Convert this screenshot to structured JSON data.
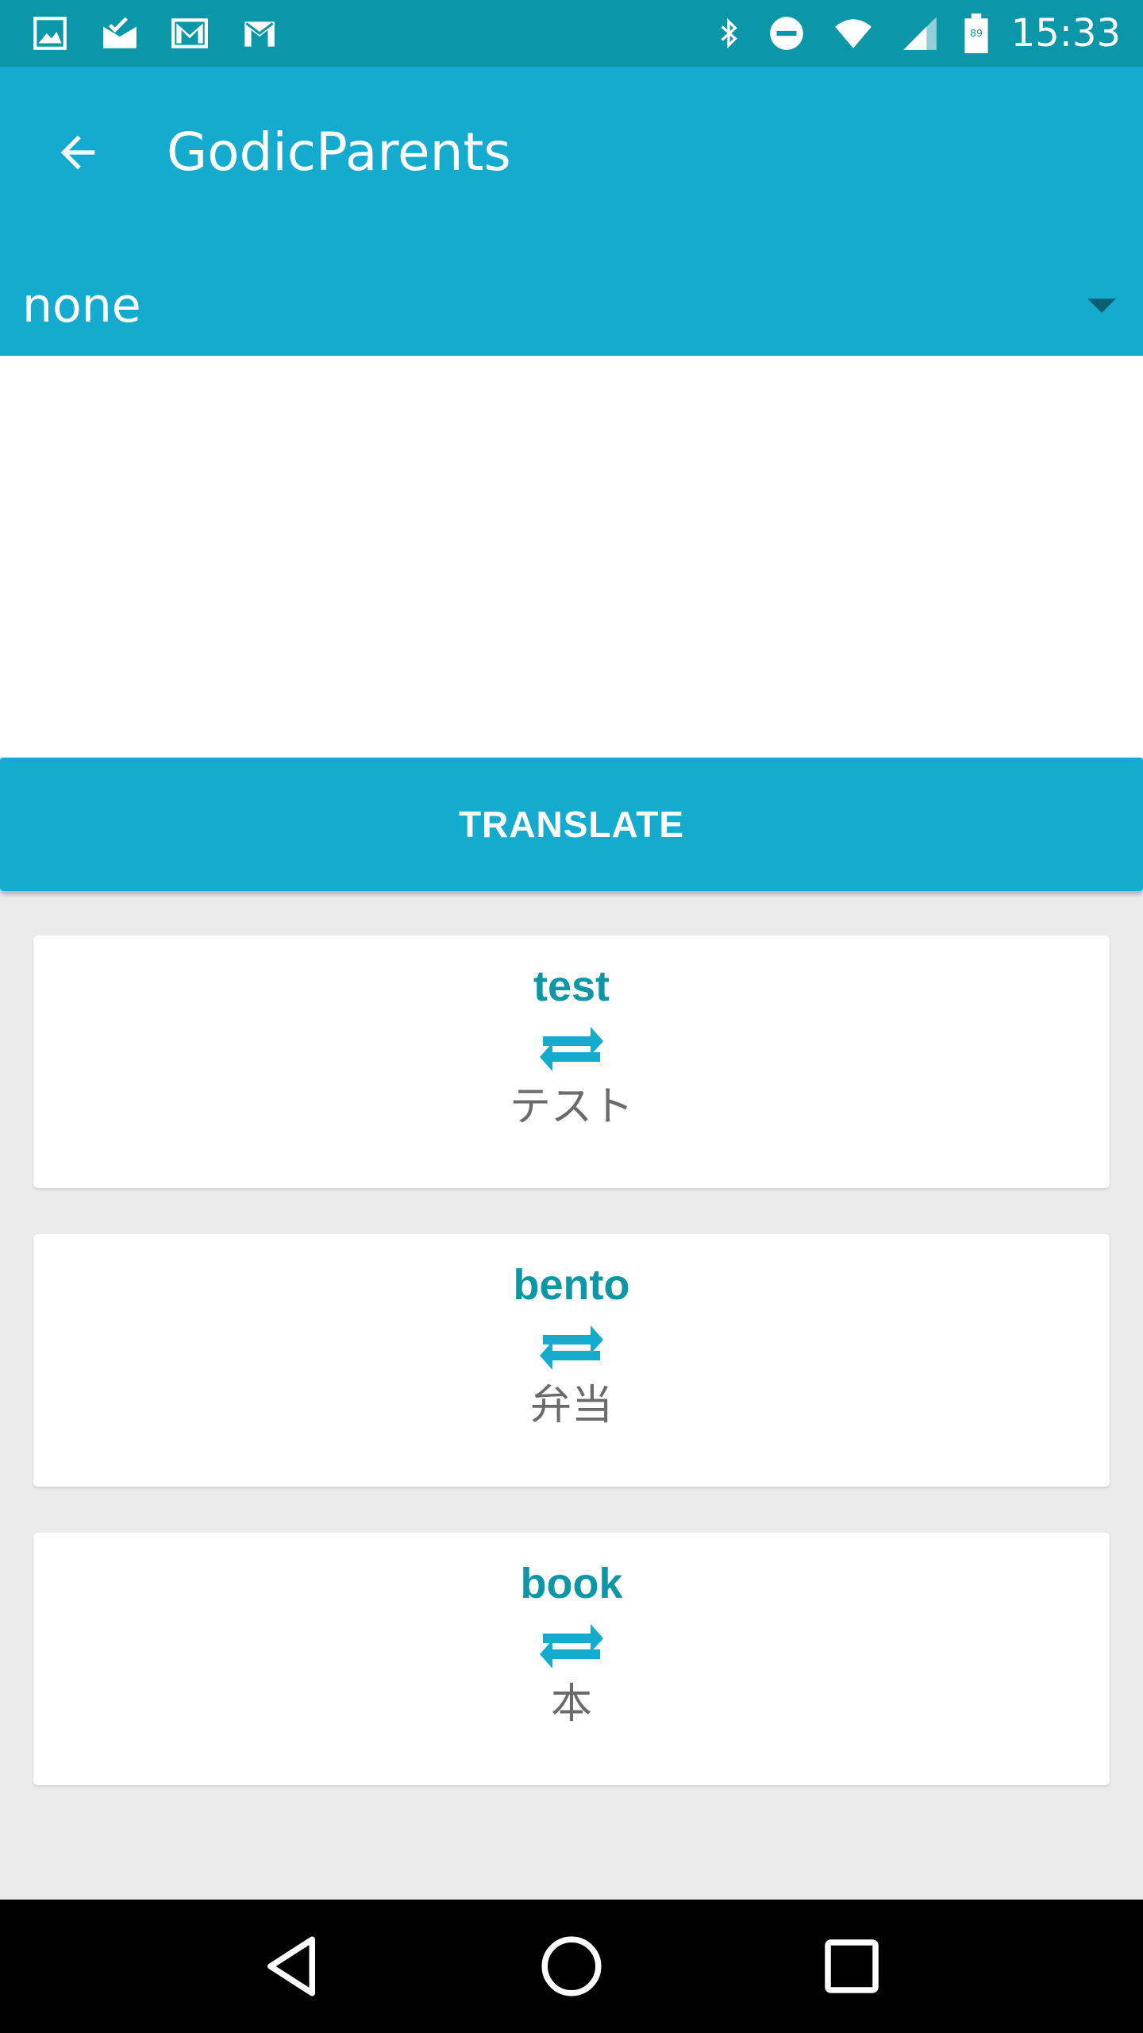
{
  "status_bar": {
    "time": "15:33",
    "battery_level": "89",
    "left_icons": [
      "image-icon",
      "mail-done-icon",
      "gmail-icon",
      "gmail-icon"
    ],
    "right_icons": [
      "bluetooth-icon",
      "do-not-disturb-icon",
      "wifi-icon",
      "cell-signal-icon",
      "battery-icon"
    ]
  },
  "app_bar": {
    "title": "GodicParents",
    "back_icon": "arrow-back-icon"
  },
  "spinner": {
    "selected_value": "none"
  },
  "input": {
    "value": "",
    "placeholder": ""
  },
  "actions": {
    "translate_label": "TRANSLATE"
  },
  "cards": [
    {
      "word": "test",
      "translation": "テスト"
    },
    {
      "word": "bento",
      "translation": "弁当"
    },
    {
      "word": "book",
      "translation": "本"
    }
  ],
  "colors": {
    "status_bar": "#0c97a8",
    "primary": "#15abcf",
    "word_text": "#0c96a6",
    "translation_text": "#6b6b6b",
    "background": "#ebebeb"
  },
  "nav_bar": {
    "icons": [
      "back-triangle-icon",
      "home-circle-icon",
      "recents-square-icon"
    ]
  }
}
